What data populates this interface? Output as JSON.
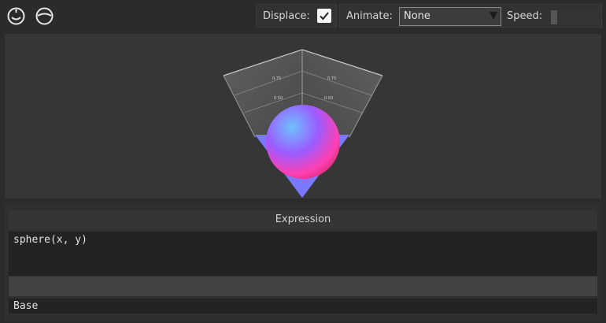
{
  "toolbar": {
    "icons": [
      "sphere-icon",
      "sphere-shade-icon"
    ],
    "displace_label": "Displace:",
    "displace_checked": true,
    "animate_label": "Animate:",
    "animate_value": "None",
    "speed_label": "Speed:",
    "speed_value": 0
  },
  "viewport": {
    "axis_ticks": [
      "0.75",
      "0.75",
      "0.50",
      "0.50"
    ],
    "sphere_gradient": [
      "#5aa8ff",
      "#9a55ff",
      "#ff44b0",
      "#ff2f6d"
    ],
    "base_color": "#7a78ff"
  },
  "panel": {
    "header": "Expression",
    "expression": "sphere(x, y)",
    "base_label": "Base"
  }
}
